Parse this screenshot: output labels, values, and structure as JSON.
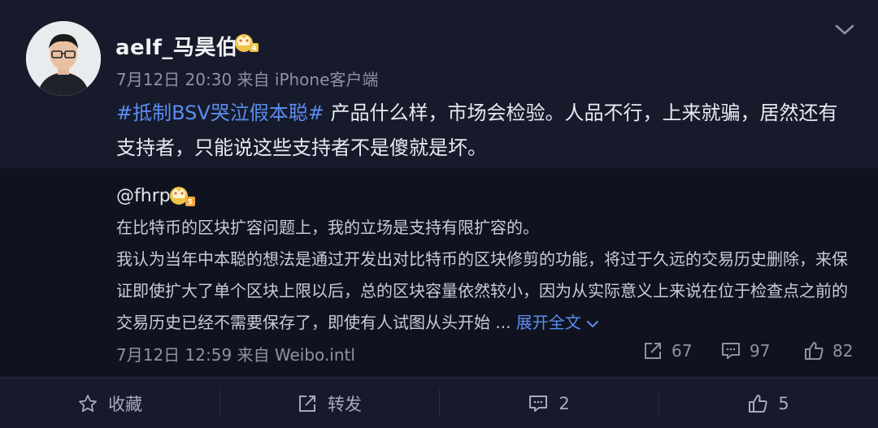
{
  "post": {
    "username": "aelf_马昊伯",
    "meta": "7月12日 20:30 来自 iPhone客户端",
    "topic": "#抵制BSV哭泣假本聪#",
    "text": " 产品什么样，市场会检验。人品不行，上来就骗，居然还有支持者，只能说这些支持者不是傻就是坏。",
    "badge_level": "4"
  },
  "repost": {
    "username": "@fhrp",
    "badge_level": "5",
    "paragraph1": "在比特币的区块扩容问题上，我的立场是支持有限扩容的。",
    "paragraph2": "我认为当年中本聪的想法是通过开发出对比特币的区块修剪的功能，将过于久远的交易历史删除，来保证即使扩大了单个区块上限以后，总的区块容量依然较小，因为从实际意义上来说在位于检查点之前的交易历史已经不需要保存了，即使有人试图从头开始 ...",
    "expand_label": "展开全文",
    "meta": "7月12日 12:59 来自 Weibo.intl",
    "reposts": "67",
    "comments": "97",
    "likes": "82"
  },
  "actions": {
    "favorite": "收藏",
    "forward": "转发",
    "comment": "2",
    "like": "5"
  },
  "colors": {
    "background": "#161a2b",
    "repost_background": "#10131f",
    "link": "#5b8def",
    "badge": "#f0c24a"
  },
  "icons": [
    "chevron-down-icon",
    "crown-badge-icon",
    "forward-icon",
    "comment-icon",
    "like-icon",
    "star-icon"
  ]
}
